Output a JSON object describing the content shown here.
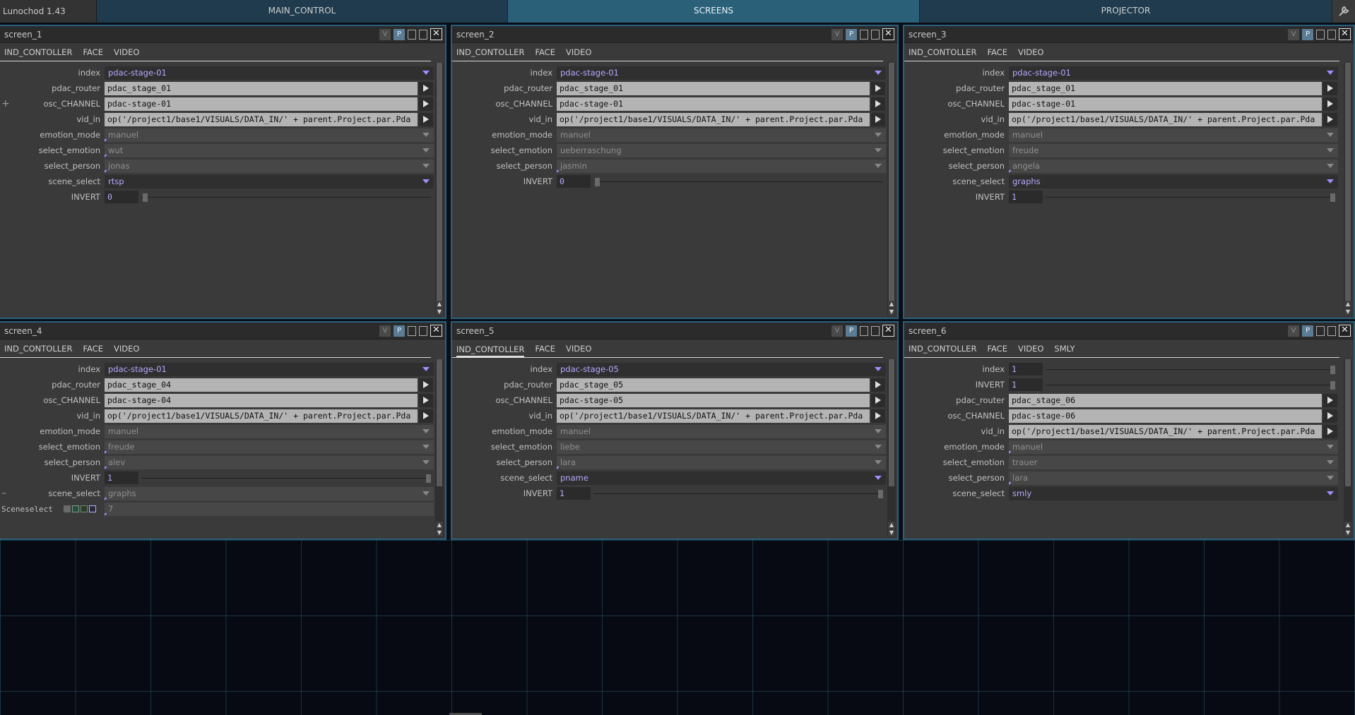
{
  "app": {
    "title": "Lunochod 1.43"
  },
  "top_tabs": [
    "MAIN_CONTROL",
    "SCREENS",
    "PROJECTOR"
  ],
  "header_icons": {
    "v": "V",
    "p": "P",
    "close": "✕"
  },
  "common": {
    "tabs3": [
      "IND_CONTOLLER",
      "FACE",
      "VIDEO"
    ],
    "tabs4": [
      "IND_CONTOLLER",
      "FACE",
      "VIDEO",
      "SMLY"
    ],
    "vid_in": "op('/project1/base1/VISUALS/DATA_IN/' + parent.Project.par.Pda"
  },
  "panels": {
    "s1": {
      "title": "screen_1",
      "rows": [
        {
          "label": "index",
          "value": "pdac-stage-01"
        },
        {
          "label": "pdac_router",
          "value": "pdac_stage_01"
        },
        {
          "label": "osc_CHANNEL",
          "value": "pdac-stage-01"
        },
        {
          "label": "vid_in"
        },
        {
          "label": "emotion_mode",
          "value": "manuel"
        },
        {
          "label": "select_emotion",
          "value": "wut"
        },
        {
          "label": "select_person",
          "value": "jonas"
        },
        {
          "label": "scene_select",
          "value": "rtsp"
        },
        {
          "label": "INVERT",
          "value": "0"
        }
      ]
    },
    "s2": {
      "title": "screen_2",
      "rows": [
        {
          "label": "index",
          "value": "pdac-stage-01"
        },
        {
          "label": "pdac_router",
          "value": "pdac_stage_01"
        },
        {
          "label": "osc_CHANNEL",
          "value": "pdac-stage-01"
        },
        {
          "label": "vid_in"
        },
        {
          "label": "emotion_mode",
          "value": "manuel"
        },
        {
          "label": "select_emotion",
          "value": "ueberraschung"
        },
        {
          "label": "select_person",
          "value": "jasmin"
        },
        {
          "label": "INVERT",
          "value": "0"
        }
      ]
    },
    "s3": {
      "title": "screen_3",
      "rows": [
        {
          "label": "index",
          "value": "pdac-stage-01"
        },
        {
          "label": "pdac_router",
          "value": "pdac_stage_01"
        },
        {
          "label": "osc_CHANNEL",
          "value": "pdac-stage-01"
        },
        {
          "label": "vid_in"
        },
        {
          "label": "emotion_mode",
          "value": "manuel"
        },
        {
          "label": "select_emotion",
          "value": "freude"
        },
        {
          "label": "select_person",
          "value": "angela"
        },
        {
          "label": "scene_select",
          "value": "graphs"
        },
        {
          "label": "INVERT",
          "value": "1"
        }
      ]
    },
    "s4": {
      "title": "screen_4",
      "rows": [
        {
          "label": "index",
          "value": "pdac-stage-01"
        },
        {
          "label": "pdac_router",
          "value": "pdac_stage_04"
        },
        {
          "label": "osc_CHANNEL",
          "value": "pdac-stage-04"
        },
        {
          "label": "vid_in"
        },
        {
          "label": "emotion_mode",
          "value": "manuel"
        },
        {
          "label": "select_emotion",
          "value": "freude"
        },
        {
          "label": "select_person",
          "value": "alev"
        },
        {
          "label": "INVERT",
          "value": "1"
        },
        {
          "label": "scene_select",
          "value": "graphs"
        },
        {
          "label": "Sceneselect",
          "value": "7"
        }
      ]
    },
    "s5": {
      "title": "screen_5",
      "rows": [
        {
          "label": "index",
          "value": "pdac-stage-05"
        },
        {
          "label": "pdac_router",
          "value": "pdac_stage_05"
        },
        {
          "label": "osc_CHANNEL",
          "value": "pdac-stage-05"
        },
        {
          "label": "vid_in"
        },
        {
          "label": "emotion_mode",
          "value": "manuel"
        },
        {
          "label": "select_emotion",
          "value": "liebe"
        },
        {
          "label": "select_person",
          "value": "lara"
        },
        {
          "label": "scene_select",
          "value": "pname"
        },
        {
          "label": "INVERT",
          "value": "1"
        }
      ]
    },
    "s6": {
      "title": "screen_6",
      "rows": [
        {
          "label": "index",
          "value": "1"
        },
        {
          "label": "INVERT",
          "value": "1"
        },
        {
          "label": "pdac_router",
          "value": "pdac_stage_06"
        },
        {
          "label": "osc_CHANNEL",
          "value": "pdac-stage-06"
        },
        {
          "label": "vid_in"
        },
        {
          "label": "emotion_mode",
          "value": "manuel"
        },
        {
          "label": "select_emotion",
          "value": "trauer"
        },
        {
          "label": "select_person",
          "value": "lara"
        },
        {
          "label": "scene_select",
          "value": "smly"
        }
      ]
    }
  }
}
